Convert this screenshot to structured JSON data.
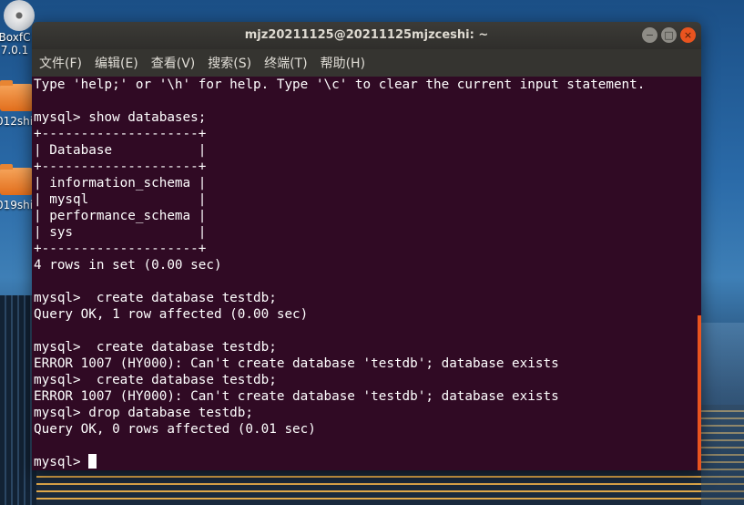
{
  "desktop": {
    "icons": [
      {
        "label_line1": "BoxfC",
        "label_line2": "7.0.1",
        "icon": "disc-icon"
      },
      {
        "label": "012shi",
        "icon": "folder-icon"
      },
      {
        "label": "019shi",
        "icon": "folder-icon"
      }
    ]
  },
  "window": {
    "title": "mjz20211125@20211125mjzceshi: ~",
    "buttons": {
      "minimize": "−",
      "maximize": "□",
      "close": "×"
    },
    "menu": [
      "文件(F)",
      "编辑(E)",
      "查看(V)",
      "搜索(S)",
      "终端(T)",
      "帮助(H)"
    ]
  },
  "terminal": {
    "lines": [
      "Type 'help;' or '\\h' for help. Type '\\c' to clear the current input statement.",
      "",
      "mysql> show databases;",
      "+--------------------+",
      "| Database           |",
      "+--------------------+",
      "| information_schema |",
      "| mysql              |",
      "| performance_schema |",
      "| sys                |",
      "+--------------------+",
      "4 rows in set (0.00 sec)",
      "",
      "mysql>  create database testdb;",
      "Query OK, 1 row affected (0.00 sec)",
      "",
      "mysql>  create database testdb;",
      "ERROR 1007 (HY000): Can't create database 'testdb'; database exists",
      "mysql>  create database testdb;",
      "ERROR 1007 (HY000): Can't create database 'testdb'; database exists",
      "mysql> drop database testdb;",
      "Query OK, 0 rows affected (0.01 sec)",
      ""
    ],
    "prompt": "mysql> "
  },
  "colors": {
    "terminal_bg": "#300a24",
    "accent": "#e9541f"
  }
}
